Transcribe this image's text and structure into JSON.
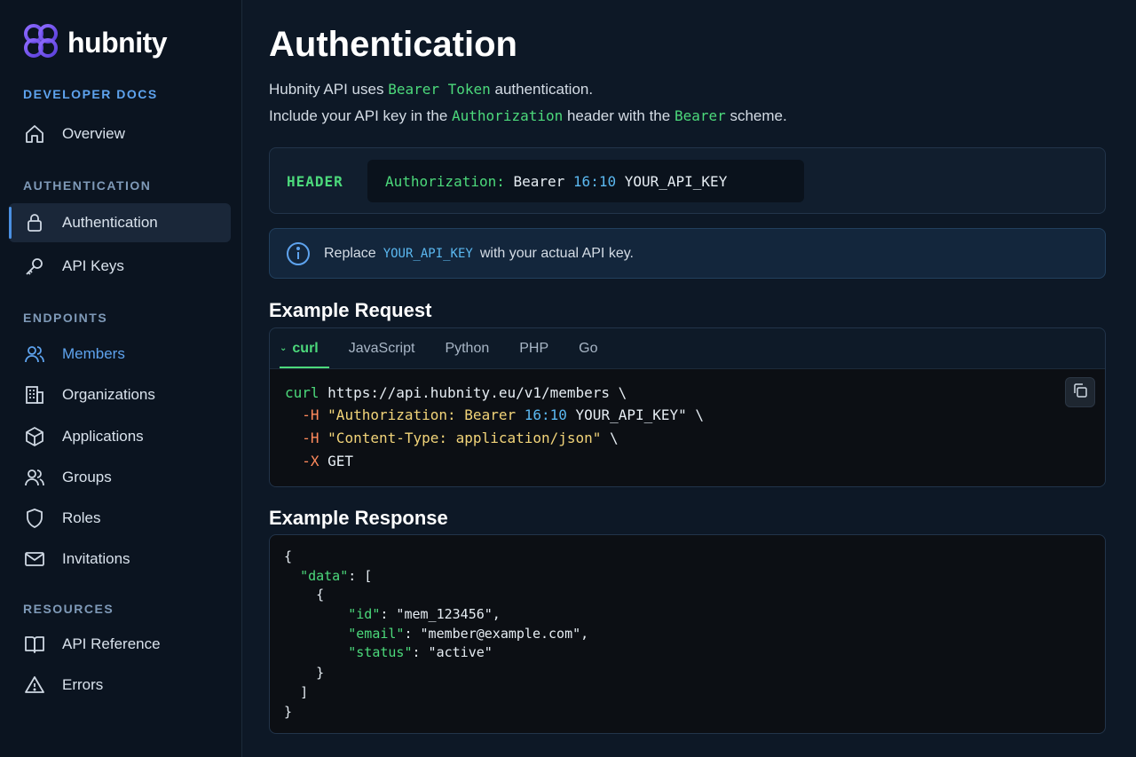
{
  "brand": {
    "name": "hubnity",
    "accent": "#7b5cf6"
  },
  "sidebar": {
    "sections": [
      {
        "title": "DEVELOPER DOCS",
        "items": [
          {
            "label": "Overview",
            "icon": "home-icon"
          }
        ]
      },
      {
        "title": "AUTHENTICATION",
        "items": [
          {
            "label": "Authentication",
            "icon": "lock-icon"
          },
          {
            "label": "API Keys",
            "icon": "key-icon"
          }
        ]
      },
      {
        "title": "ENDPOINTS",
        "items": [
          {
            "label": "Members",
            "icon": "users-icon"
          },
          {
            "label": "Organizations",
            "icon": "building-icon"
          },
          {
            "label": "Applications",
            "icon": "cube-icon"
          },
          {
            "label": "Groups",
            "icon": "users-icon"
          },
          {
            "label": "Roles",
            "icon": "shield-icon"
          },
          {
            "label": "Invitations",
            "icon": "mail-icon"
          }
        ]
      },
      {
        "title": "RESOURCES",
        "items": [
          {
            "label": "API Reference",
            "icon": "book-icon"
          },
          {
            "label": "Errors",
            "icon": "warning-icon"
          }
        ]
      }
    ],
    "active_item": "Authentication"
  },
  "main": {
    "title": "Authentication",
    "intro1": {
      "pre": "Hubnity API uses ",
      "code": "Bearer Token",
      "post": " authentication."
    },
    "intro2": {
      "pre": "Include your API key in the ",
      "code1": "Authorization",
      "mid": " header with the ",
      "code2": "Bearer",
      "post": " scheme."
    },
    "header_box": {
      "label": "HEADER",
      "key": "Authorization:",
      "scheme": " Bearer ",
      "time": "16:10",
      "value": " YOUR_API_KEY"
    },
    "info": {
      "pre": "Replace",
      "code": "YOUR_API_KEY",
      "post": "with your actual API key."
    },
    "request": {
      "title": "Example Request",
      "tabs": [
        "curl",
        "JavaScript",
        "Python",
        "PHP",
        "Go"
      ],
      "active_tab": "curl",
      "line1": {
        "cmd": "curl",
        "url": " https://api.hubnity.eu/v1/members \\"
      },
      "line2": {
        "flag": "-H",
        "s1": "\"Authorization: Bearer ",
        "time": "16:10",
        "s2": " YOUR_API_KEY\"",
        "tail": " \\"
      },
      "line3": {
        "flag": "-H",
        "s1": "\"Content-Type: application/json\"",
        "tail": " \\"
      },
      "line4": {
        "flag": "-X",
        "method": " GET"
      }
    },
    "response": {
      "title": "Example Response",
      "open_brace": "{",
      "data_key": "\"data\"",
      "data_sep": ": [",
      "obj_open": "{",
      "id_key": "\"id\"",
      "id_val": ": \"mem_123456\",",
      "email_key": "\"email\"",
      "email_val": ": \"member@example.com\",",
      "status_key": "\"status\"",
      "status_val": ": \"active\"",
      "obj_close": "}",
      "arr_close": "]",
      "close_brace": "}"
    }
  }
}
